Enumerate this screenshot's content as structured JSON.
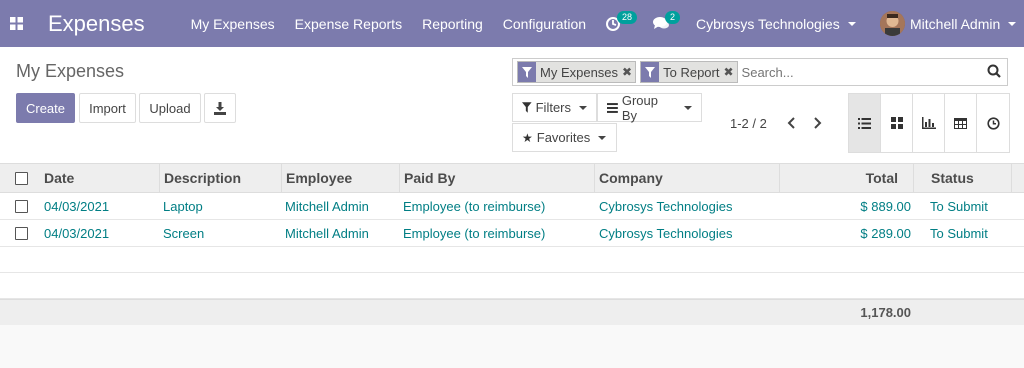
{
  "navbar": {
    "apps_icon": "grid-icon",
    "brand": "Expenses",
    "menu": [
      "My Expenses",
      "Expense Reports",
      "Reporting",
      "Configuration"
    ],
    "activity_count": "28",
    "messages_count": "2",
    "company": "Cybrosys Technologies",
    "user": "Mitchell Admin"
  },
  "control": {
    "breadcrumb": "My Expenses",
    "create": "Create",
    "import": "Import",
    "upload": "Upload",
    "download_icon": "download-icon"
  },
  "search": {
    "facets": [
      "My Expenses",
      "To Report"
    ],
    "placeholder": "Search..."
  },
  "filters": {
    "filters_label": "Filters",
    "group_by_label": "Group By",
    "favorites_label": "Favorites"
  },
  "pager": {
    "value": "1-2 / 2"
  },
  "table": {
    "headers": {
      "date": "Date",
      "description": "Description",
      "employee": "Employee",
      "paid_by": "Paid By",
      "company": "Company",
      "total": "Total",
      "status": "Status"
    },
    "rows": [
      {
        "date": "04/03/2021",
        "description": "Laptop",
        "employee": "Mitchell Admin",
        "paid_by": "Employee (to reimburse)",
        "company": "Cybrosys Technologies",
        "total": "$ 889.00",
        "status": "To Submit"
      },
      {
        "date": "04/03/2021",
        "description": "Screen",
        "employee": "Mitchell Admin",
        "paid_by": "Employee (to reimburse)",
        "company": "Cybrosys Technologies",
        "total": "$ 289.00",
        "status": "To Submit"
      }
    ],
    "footer_total": "1,178.00"
  },
  "colors": {
    "primary": "#7c7bad",
    "link": "#017e84",
    "badge": "#00a09d"
  }
}
